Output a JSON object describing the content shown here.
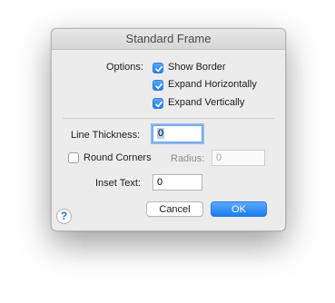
{
  "window": {
    "title": "Standard Frame"
  },
  "options": {
    "label": "Options:",
    "show_border": {
      "label": "Show Border",
      "checked": true
    },
    "expand_horizontally": {
      "label": "Expand Horizontally",
      "checked": true
    },
    "expand_vertically": {
      "label": "Expand Vertically",
      "checked": true
    }
  },
  "line_thickness": {
    "label": "Line Thickness:",
    "value": "0"
  },
  "round_corners": {
    "label": "Round Corners",
    "checked": false
  },
  "radius": {
    "label": "Radius:",
    "value": "0"
  },
  "inset_text": {
    "label": "Inset Text:",
    "value": "0"
  },
  "buttons": {
    "cancel": "Cancel",
    "ok": "OK",
    "help": "?"
  },
  "colors": {
    "accent": "#1a7ff0",
    "window_bg": "#ececec"
  }
}
